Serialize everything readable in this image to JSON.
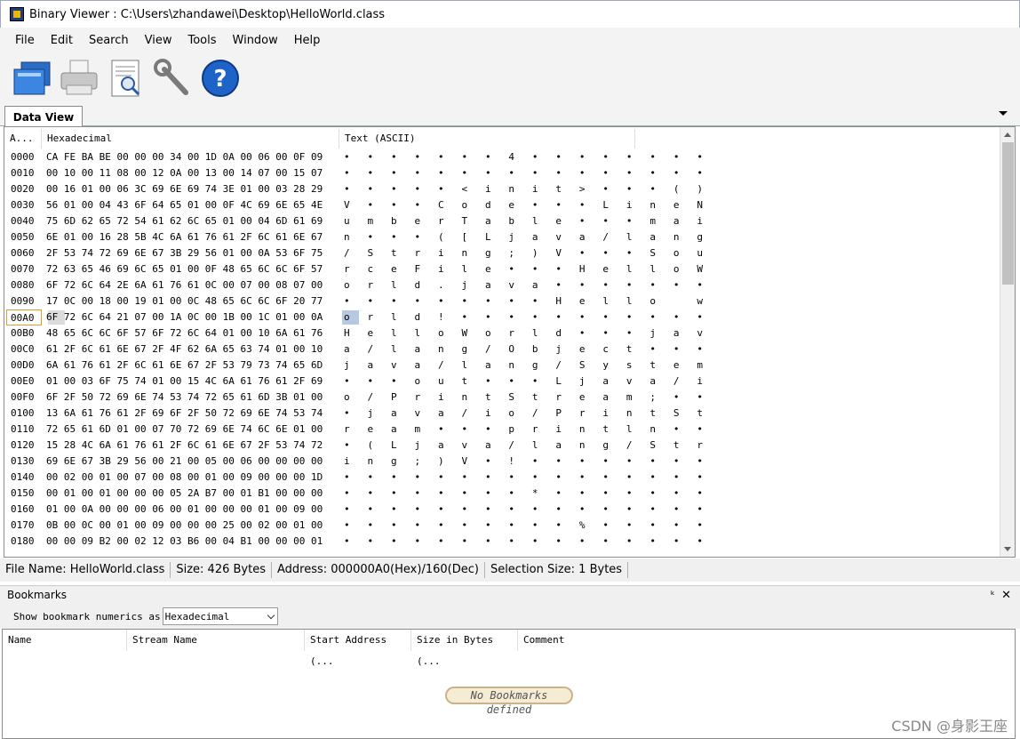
{
  "window": {
    "title": "Binary Viewer : C:\\Users\\zhandawei\\Desktop\\HelloWorld.class"
  },
  "menu": [
    "File",
    "Edit",
    "Search",
    "View",
    "Tools",
    "Window",
    "Help"
  ],
  "toolbar": {
    "icons": [
      "open-folder-icon",
      "print-icon",
      "print-preview-icon",
      "tools-wrench-icon",
      "help-icon"
    ]
  },
  "tab": {
    "label": "Data View"
  },
  "columns": {
    "address": "A...",
    "hex": "Hexadecimal",
    "text": "Text (ASCII)"
  },
  "rows": [
    {
      "a": "0000",
      "h": "CA FE BA BE 00 00 00 34 00 1D 0A 00 06 00 0F 09",
      "t": "•   •   •   •   •   •   •   4   •   •   •   •   •   •   •   •"
    },
    {
      "a": "0010",
      "h": "00 10 00 11 08 00 12 0A 00 13 00 14 07 00 15 07",
      "t": "•   •   •   •   •   •   •   •   •   •   •   •   •   •   •   •"
    },
    {
      "a": "0020",
      "h": "00 16 01 00 06 3C 69 6E 69 74 3E 01 00 03 28 29",
      "t": "•   •   •   •   •   <   i   n   i   t   >   •   •   •   (   )"
    },
    {
      "a": "0030",
      "h": "56 01 00 04 43 6F 64 65 01 00 0F 4C 69 6E 65 4E",
      "t": "V   •   •   •   C   o   d   e   •   •   •   L   i   n   e   N"
    },
    {
      "a": "0040",
      "h": "75 6D 62 65 72 54 61 62 6C 65 01 00 04 6D 61 69",
      "t": "u   m   b   e   r   T   a   b   l   e   •   •   •   m   a   i"
    },
    {
      "a": "0050",
      "h": "6E 01 00 16 28 5B 4C 6A 61 76 61 2F 6C 61 6E 67",
      "t": "n   •   •   •   (   [   L   j   a   v   a   /   l   a   n   g"
    },
    {
      "a": "0060",
      "h": "2F 53 74 72 69 6E 67 3B 29 56 01 00 0A 53 6F 75",
      "t": "/   S   t   r   i   n   g   ;   )   V   •   •   •   S   o   u"
    },
    {
      "a": "0070",
      "h": "72 63 65 46 69 6C 65 01 00 0F 48 65 6C 6C 6F 57",
      "t": "r   c   e   F   i   l   e   •   •   •   H   e   l   l   o   W"
    },
    {
      "a": "0080",
      "h": "6F 72 6C 64 2E 6A 61 76 61 0C 00 07 00 08 07 00",
      "t": "o   r   l   d   .   j   a   v   a   •   •   •   •   •   •   •"
    },
    {
      "a": "0090",
      "h": "17 0C 00 18 00 19 01 00 0C 48 65 6C 6C 6F 20 77",
      "t": "•   •   •   •   •   •   •   •   •   H   e   l   l   o       w"
    },
    {
      "a": "00A0",
      "h": "6F 72 6C 64 21 07 00 1A 0C 00 1B 00 1C 01 00 0A",
      "t": "o   r   l   d   !   •   •   •   •   •   •   •   •   •   •   •"
    },
    {
      "a": "00B0",
      "h": "48 65 6C 6C 6F 57 6F 72 6C 64 01 00 10 6A 61 76",
      "t": "H   e   l   l   o   W   o   r   l   d   •   •   •   j   a   v"
    },
    {
      "a": "00C0",
      "h": "61 2F 6C 61 6E 67 2F 4F 62 6A 65 63 74 01 00 10",
      "t": "a   /   l   a   n   g   /   O   b   j   e   c   t   •   •   •"
    },
    {
      "a": "00D0",
      "h": "6A 61 76 61 2F 6C 61 6E 67 2F 53 79 73 74 65 6D",
      "t": "j   a   v   a   /   l   a   n   g   /   S   y   s   t   e   m"
    },
    {
      "a": "00E0",
      "h": "01 00 03 6F 75 74 01 00 15 4C 6A 61 76 61 2F 69",
      "t": "•   •   •   o   u   t   •   •   •   L   j   a   v   a   /   i"
    },
    {
      "a": "00F0",
      "h": "6F 2F 50 72 69 6E 74 53 74 72 65 61 6D 3B 01 00",
      "t": "o   /   P   r   i   n   t   S   t   r   e   a   m   ;   •   •"
    },
    {
      "a": "0100",
      "h": "13 6A 61 76 61 2F 69 6F 2F 50 72 69 6E 74 53 74",
      "t": "•   j   a   v   a   /   i   o   /   P   r   i   n   t   S   t"
    },
    {
      "a": "0110",
      "h": "72 65 61 6D 01 00 07 70 72 69 6E 74 6C 6E 01 00",
      "t": "r   e   a   m   •   •   •   p   r   i   n   t   l   n   •   •"
    },
    {
      "a": "0120",
      "h": "15 28 4C 6A 61 76 61 2F 6C 61 6E 67 2F 53 74 72",
      "t": "•   (   L   j   a   v   a   /   l   a   n   g   /   S   t   r"
    },
    {
      "a": "0130",
      "h": "69 6E 67 3B 29 56 00 21 00 05 00 06 00 00 00 00",
      "t": "i   n   g   ;   )   V   •   !   •   •   •   •   •   •   •   •"
    },
    {
      "a": "0140",
      "h": "00 02 00 01 00 07 00 08 00 01 00 09 00 00 00 1D",
      "t": "•   •   •   •   •   •   •   •   •   •   •   •   •   •   •   •"
    },
    {
      "a": "0150",
      "h": "00 01 00 01 00 00 00 05 2A B7 00 01 B1 00 00 00",
      "t": "•   •   •   •   •   •   •   •   *   •   •   •   •   •   •   •"
    },
    {
      "a": "0160",
      "h": "01 00 0A 00 00 00 06 00 01 00 00 00 01 00 09 00",
      "t": "•   •   •   •   •   •   •   •   •   •   •   •   •   •   •   •"
    },
    {
      "a": "0170",
      "h": "0B 00 0C 00 01 00 09 00 00 00 25 00 02 00 01 00",
      "t": "•   •   •   •   •   •   •   •   •   •   %   •   •   •   •   •"
    },
    {
      "a": "0180",
      "h": "00 00 09 B2 00 02 12 03 B6 00 04 B1 00 00 00 01",
      "t": "•   •   •   •   •   •   •   •   •   •   •   •   •   •   •   •"
    }
  ],
  "status": {
    "file_name": "File Name: HelloWorld.class",
    "size": "Size: 426 Bytes",
    "address": "Address: 000000A0(Hex)/160(Dec)",
    "selection": "Selection Size: 1 Bytes"
  },
  "bookmarks": {
    "title": "Bookmarks",
    "option_label": "Show bookmark numerics as",
    "option_value": "Hexadecimal",
    "columns": [
      "Name",
      "Stream Name",
      "Start Address (...",
      "Size in Bytes (...",
      "Comment"
    ],
    "empty_text": "No Bookmarks defined"
  },
  "watermark": "CSDN @身影王座"
}
